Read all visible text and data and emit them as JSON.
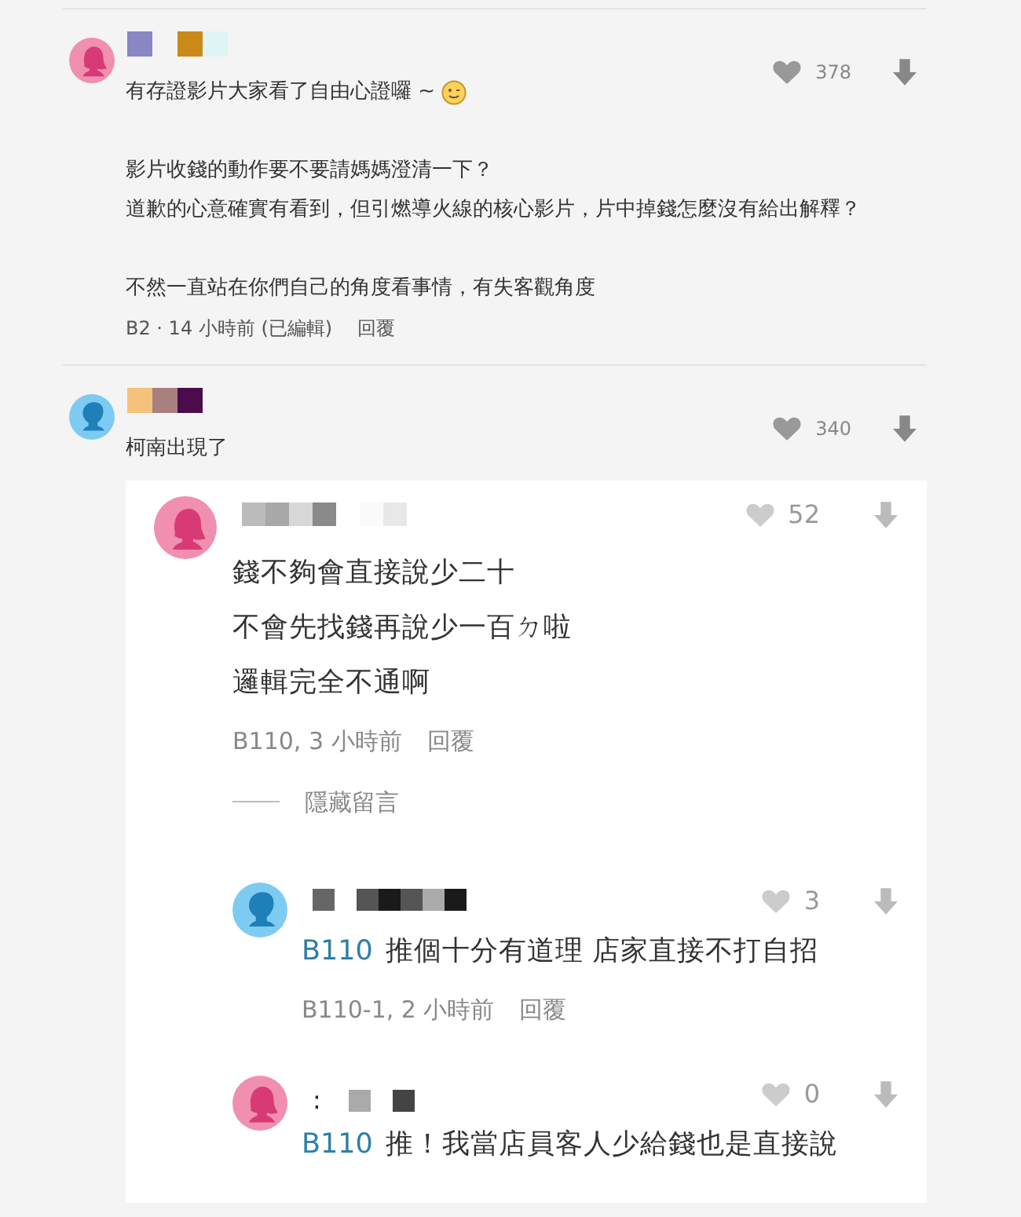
{
  "comments": [
    {
      "avatar": {
        "kind": "female",
        "color": "#f08fb0"
      },
      "name_mosaic": [
        {
          "color": "#8a86c4"
        },
        {
          "color": "#f4f4f4"
        },
        {
          "color": "#c98a1a"
        },
        {
          "color": "#dff5f5"
        },
        {
          "color": "#f4f4f4"
        }
      ],
      "likes": "378",
      "paragraphs": [
        [
          "有存證影片大家看了自由心證囉 ~"
        ],
        [
          "影片收錢的動作要不要請媽媽澄清一下？",
          "道歉的心意確實有看到，但引燃導火線的核心影片，片中掉錢怎麼沒有給出解釋？"
        ],
        [
          "不然一直站在你們自己的角度看事情，有失客觀角度"
        ]
      ],
      "emoji_after_first_line": true,
      "meta": "B2 · 14 小時前 (已編輯)",
      "reply": "回覆"
    },
    {
      "avatar": {
        "kind": "male",
        "color": "#7ecbf2"
      },
      "name_mosaic": [
        {
          "color": "#f4c27a"
        },
        {
          "color": "#a88080"
        },
        {
          "color": "#4a0c4a"
        }
      ],
      "likes": "340",
      "paragraphs": [
        [
          "柯南出現了"
        ]
      ],
      "emoji_after_first_line": false,
      "replies": [
        {
          "avatar": {
            "kind": "female",
            "color": "#f08fb0"
          },
          "name_mosaic": [
            {
              "color": "#bbbbbb"
            },
            {
              "color": "#a8a8a8"
            },
            {
              "color": "#d8d8d8"
            },
            {
              "color": "#8a8a8a"
            },
            {
              "color": "#ffffff"
            },
            {
              "color": "#fafafa"
            },
            {
              "color": "#e8e8e8"
            }
          ],
          "likes": "52",
          "lines": [
            "錢不夠會直接說少二十",
            "不會先找錢再說少一百ㄉ啦",
            "邏輯完全不通啊"
          ],
          "meta": "B110, 3 小時前",
          "reply": "回覆",
          "hide": "隱藏留言",
          "children": [
            {
              "avatar": {
                "kind": "male",
                "color": "#7ecbf2"
              },
              "name_mosaic": [
                {
                  "color": "#666666"
                },
                {
                  "color": "#ffffff"
                },
                {
                  "color": "#555555"
                },
                {
                  "color": "#1a1a1a"
                },
                {
                  "color": "#555555"
                },
                {
                  "color": "#aaaaaa"
                },
                {
                  "color": "#1a1a1a"
                }
              ],
              "likes": "3",
              "tag": "B110",
              "text": "推個十分有道理 店家直接不打自招",
              "meta": "B110-1, 2 小時前",
              "reply": "回覆"
            },
            {
              "avatar": {
                "kind": "female",
                "color": "#f08fb0"
              },
              "prefix": ":",
              "name_mosaic": [
                {
                  "color": "#ffffff"
                },
                {
                  "color": "#aaaaaa"
                },
                {
                  "color": "#ffffff"
                },
                {
                  "color": "#444444"
                }
              ],
              "likes": "0",
              "tag": "B110",
              "text": "推！我當店員客人少給錢也是直接說"
            }
          ]
        }
      ]
    }
  ]
}
